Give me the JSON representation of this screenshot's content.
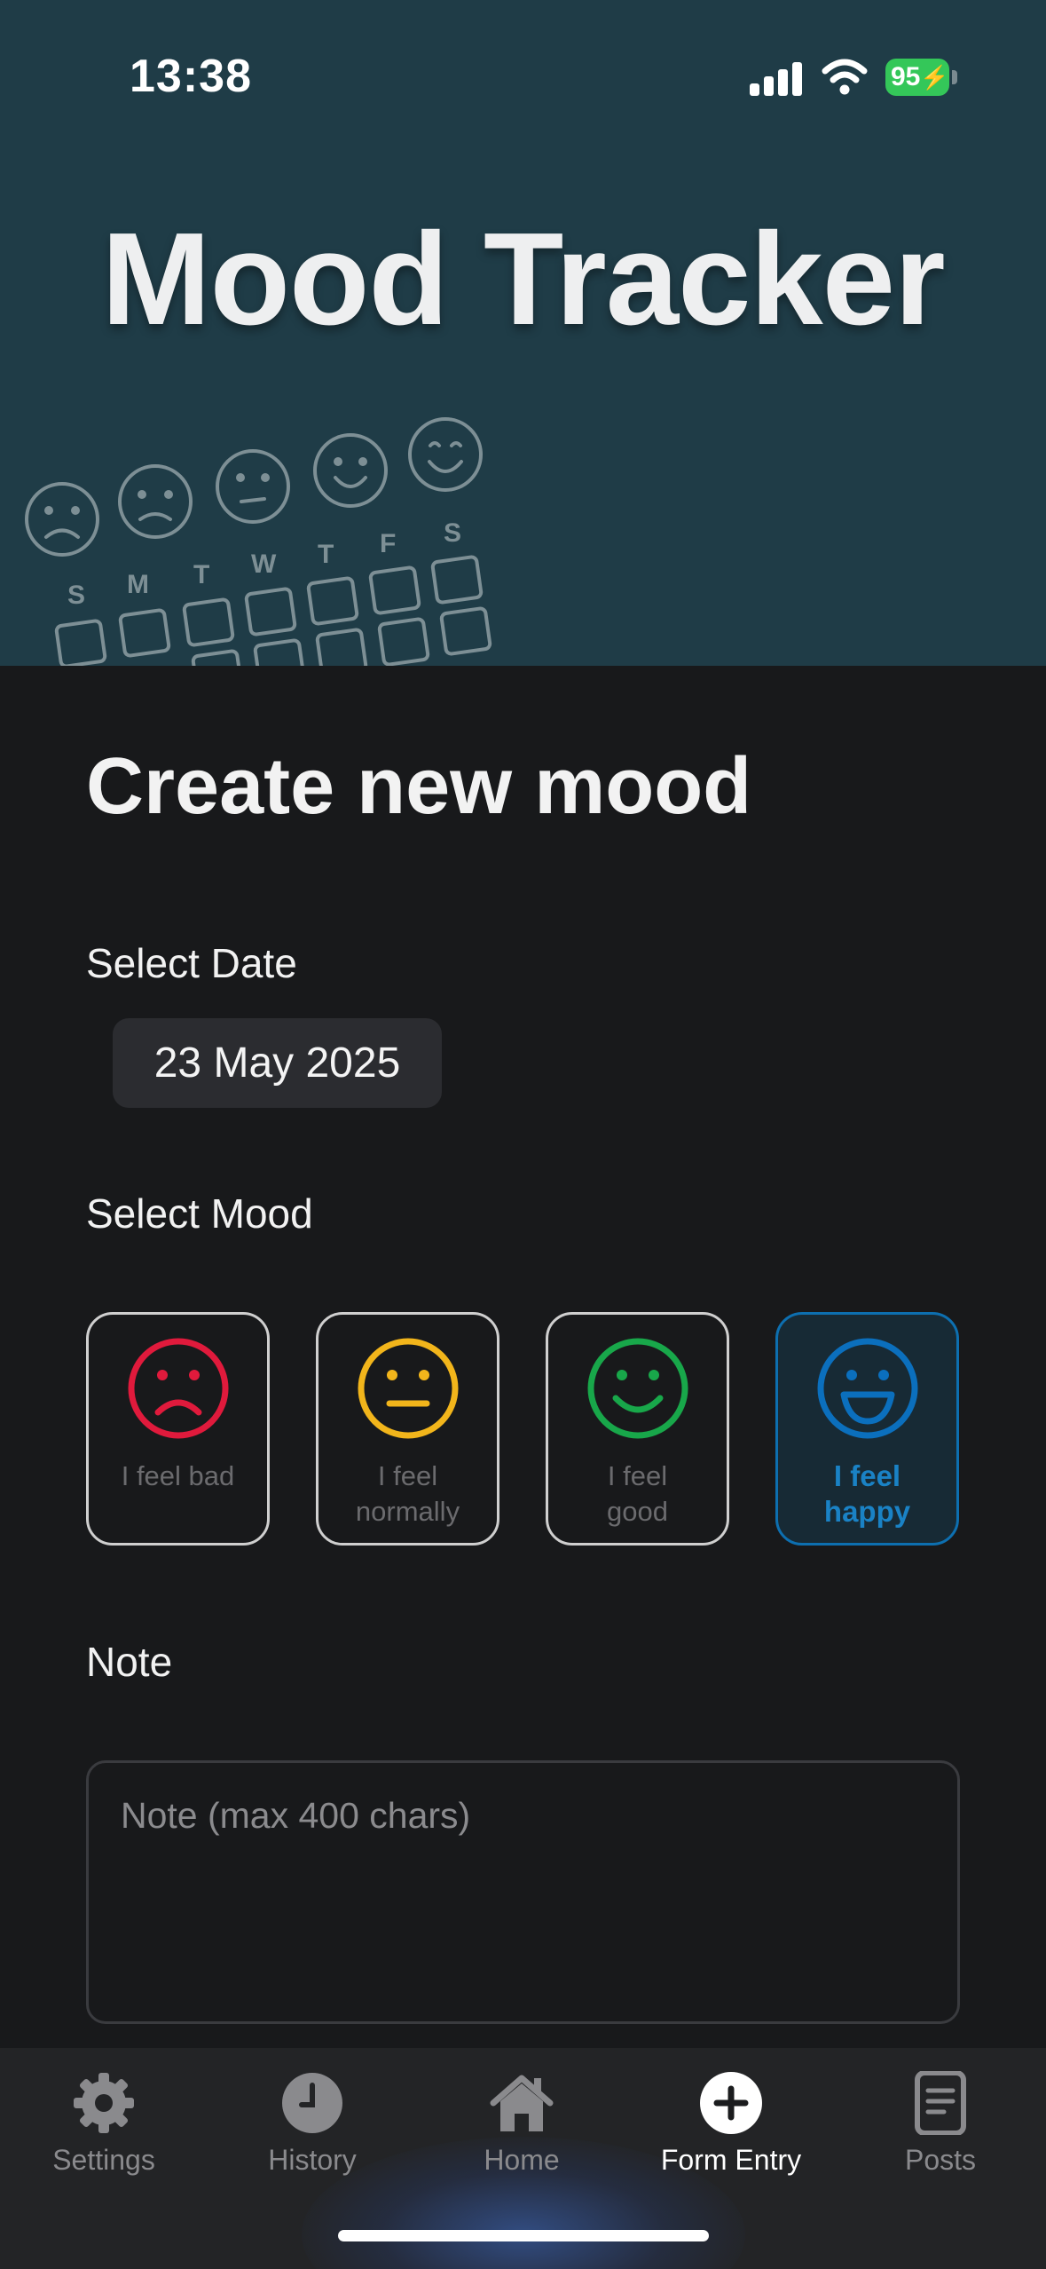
{
  "status_bar": {
    "time": "13:38",
    "battery": "95"
  },
  "header": {
    "title": "Mood Tracker",
    "art_weekdays": [
      "S",
      "M",
      "T",
      "W",
      "T",
      "F",
      "S"
    ]
  },
  "form": {
    "title": "Create new mood",
    "date_label": "Select Date",
    "date_value": "23 May 2025",
    "mood_label": "Select Mood",
    "moods": [
      {
        "line1": "I feel bad",
        "line2": "",
        "color": "#e01a3c",
        "selected": false
      },
      {
        "line1": "I feel",
        "line2": "normally",
        "color": "#f2b51b",
        "selected": false
      },
      {
        "line1": "I feel",
        "line2": "good",
        "color": "#18a74a",
        "selected": false
      },
      {
        "line1": "I feel",
        "line2": "happy",
        "color": "#0b6fbd",
        "selected": true
      }
    ],
    "note_label": "Note",
    "note_placeholder": "Note (max 400 chars)"
  },
  "tabbar": {
    "tabs": [
      {
        "label": "Settings",
        "icon": "gear-icon"
      },
      {
        "label": "History",
        "icon": "clock-icon"
      },
      {
        "label": "Home",
        "icon": "home-icon"
      },
      {
        "label": "Form Entry",
        "icon": "plus-circle-icon",
        "active": true
      },
      {
        "label": "Posts",
        "icon": "document-icon"
      }
    ]
  }
}
